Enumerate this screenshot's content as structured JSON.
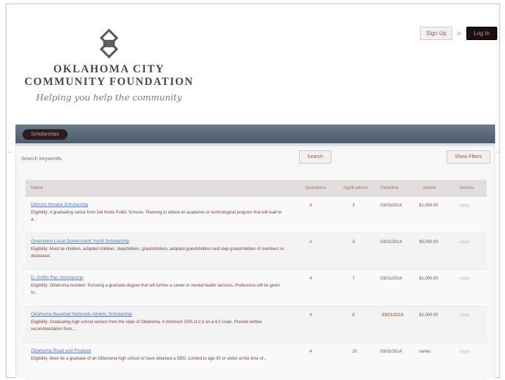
{
  "brand": {
    "line1": "OKLAHOMA CITY",
    "line2": "COMMUNITY FOUNDATION",
    "tagline": "Helping you help the community"
  },
  "auth": {
    "signup_label": "Sign Up",
    "separator": "or",
    "login_label": "Log In"
  },
  "nav": {
    "pill_label": "Scholarships"
  },
  "search": {
    "placeholder": "Search keywords",
    "button_label": "Search",
    "filters_label": "Show Filters"
  },
  "table": {
    "headers": {
      "name": "Name",
      "questions": "Questions",
      "applications": "Applications",
      "deadline": "Deadline",
      "award": "Award",
      "actions": "Actions"
    },
    "rows": [
      {
        "title": "Ditmore Horace Scholarship",
        "description": "Eligibility: A graduating senior from Del Norte Public Schools. Planning to attend an academic or technological program that will lead to a...",
        "questions": "3",
        "applications": "3",
        "deadline": "03/03/2014",
        "award": "$1,000.00",
        "action": "Apply"
      },
      {
        "title": "Greenview Local Government Youth Scholarship",
        "description": "Eligibility: Must be children, adopted children, stepchildren, grandchildren, adopted grandchildren and step grandchildren of members or deceased.",
        "questions": "2",
        "applications": "3",
        "deadline": "03/01/2014",
        "award": "$3,000.00",
        "action": "Apply"
      },
      {
        "title": "D. Griffin Pan Scholarship",
        "description": "Eligibility: Oklahoma resident. Pursuing a graduate degree that will further a career in mental health services. Preference will be given to...",
        "questions": "4",
        "applications": "7",
        "deadline": "03/01/2014",
        "award": "$1,000.00",
        "action": "Apply"
      },
      {
        "title": "Oklahoma Baseball Nationals Athletic Scholarship",
        "description": "Eligibility: Graduating high school seniors from the state of Oklahoma. A minimum GPA of 2.5 on a 4.0 scale. Provide written recommendation from...",
        "questions": "4",
        "applications": "8",
        "deadline": "03/01/2014",
        "award": "$1,000.00",
        "action": "Apply",
        "deadline_highlight": true
      },
      {
        "title": "Oklahoma Road and Produce",
        "description": "Eligibility: Must be a graduate of an Oklahoma high school or have obtained a GED. Limited to age 30 or under at the time of...",
        "questions": "4",
        "applications": "20",
        "deadline": "03/01/2014",
        "award": "varies",
        "action": "Apply"
      }
    ]
  },
  "colors": {
    "bar_blue": "#556574",
    "link_blue": "#5a78a6",
    "desc_red": "#7a3f3f",
    "login_bg": "#1c0f0f"
  }
}
